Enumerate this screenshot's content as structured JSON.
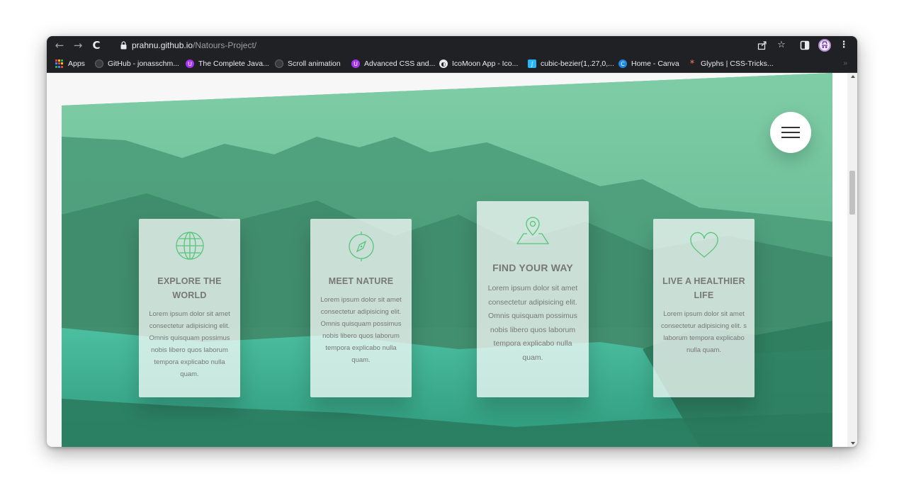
{
  "browser": {
    "url_host": "prahnu.github.io",
    "url_path": "/Natours-Project/",
    "nav": {
      "back": "←",
      "forward": "→",
      "reload": "C"
    }
  },
  "bookmarks": [
    {
      "label": "Apps",
      "icon": "apps-grid-icon",
      "color": "#e8eaed"
    },
    {
      "label": "GitHub - jonasschm...",
      "icon": "github-icon",
      "color": "#3c3c3c"
    },
    {
      "label": "The Complete Java...",
      "icon": "udemy-icon",
      "color": "#a435f0"
    },
    {
      "label": "Scroll animation",
      "icon": "github-icon",
      "color": "#3c3c3c"
    },
    {
      "label": "Advanced CSS and...",
      "icon": "udemy-icon",
      "color": "#a435f0"
    },
    {
      "label": "IcoMoon App - Ico...",
      "icon": "icomoon-icon",
      "color": "#e8eaed"
    },
    {
      "label": "cubic-bezier(1,.27,0,...",
      "icon": "cubic-bezier-icon",
      "color": "#29b6f6"
    },
    {
      "label": "Home - Canva",
      "icon": "canva-icon",
      "color": "#1e88e5"
    },
    {
      "label": "Glyphs | CSS-Tricks...",
      "icon": "css-tricks-icon",
      "color": "#ff7a59"
    }
  ],
  "features": [
    {
      "title": "Explore the world",
      "text": "Lorem ipsum dolor sit amet consectetur adipisicing elit. Omnis quisquam possimus nobis libero quos laborum tempora explicabo nulla quam.",
      "icon": "globe-icon"
    },
    {
      "title": "Meet nature",
      "text": "Lorem ipsum dolor sit amet consectetur adipisicing elit. Omnis quisquam possimus nobis libero quos laborum tempora explicabo nulla quam.",
      "icon": "compass-icon"
    },
    {
      "title": "Find your way",
      "text": "Lorem ipsum dolor sit amet consectetur adipisicing elit. Omnis quisquam possimus nobis libero quos laborum tempora explicabo nulla quam.",
      "icon": "map-pin-icon"
    },
    {
      "title": "Live a healthier life",
      "text": "Lorem ipsum dolor sit amet consectetur adipisicing elit. s laborum tempora explicabo nulla quam.",
      "icon": "heart-icon"
    }
  ],
  "colors": {
    "accent_green": "#55c57a",
    "hero_green": "#28b485"
  }
}
